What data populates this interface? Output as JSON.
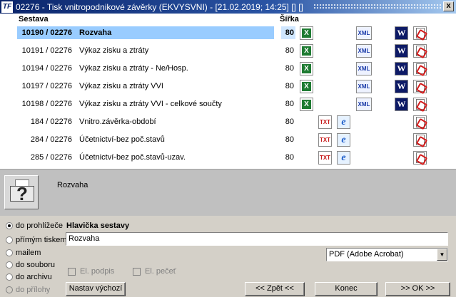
{
  "window": {
    "title": "02276 - Tisk vnitropodnikové závěrky (EKVYSVNI) - [21.02.2019; 14:25] [] []",
    "app_icon": "TF",
    "close_label": "x"
  },
  "list": {
    "headers": {
      "sestava": "Sestava",
      "sirka": "Šířka"
    },
    "rows": [
      {
        "code": "10190 / 02276",
        "name": "Rozvaha",
        "width": "80",
        "selected": true,
        "icons": [
          "xls-icon",
          "xml-icon",
          "word-icon",
          "pdf-icon"
        ]
      },
      {
        "code": "10191 / 02276",
        "name": "Výkaz zisku a ztráty",
        "width": "80",
        "icons": [
          "xls-icon",
          "xml-icon",
          "word-icon",
          "pdf-icon"
        ]
      },
      {
        "code": "10194 / 02276",
        "name": "Výkaz zisku a ztráty - Ne/Hosp.",
        "width": "80",
        "icons": [
          "xls-icon",
          "xml-icon",
          "word-icon",
          "pdf-icon"
        ]
      },
      {
        "code": "10197 / 02276",
        "name": "Výkaz zisku a ztráty VVI",
        "width": "80",
        "icons": [
          "xls-icon",
          "xml-icon",
          "word-icon",
          "pdf-icon"
        ]
      },
      {
        "code": "10198 / 02276",
        "name": "Výkaz zisku a ztráty VVI - celkové součty",
        "width": "80",
        "icons": [
          "xls-icon",
          "xml-icon",
          "word-icon",
          "pdf-icon"
        ]
      },
      {
        "code": "184 / 02276",
        "name": "Vnitro.závěrka-období",
        "width": "80",
        "icons": [
          "txt-icon",
          "ie-icon",
          "pdf-icon"
        ]
      },
      {
        "code": "284 / 02276",
        "name": "Účetnictví-bez poč.stavů",
        "width": "80",
        "icons": [
          "txt-icon",
          "ie-icon",
          "pdf-icon"
        ]
      },
      {
        "code": "285 / 02276",
        "name": "Účetnictví-bez poč.stavů-uzav.",
        "width": "80",
        "icons": [
          "txt-icon",
          "ie-icon",
          "pdf-icon"
        ]
      }
    ]
  },
  "info": {
    "selected_name": "Rozvaha",
    "icon": "printer-question-icon"
  },
  "output": {
    "options": [
      {
        "label": "do prohlížeče",
        "checked": true
      },
      {
        "label": "přímým tiskem"
      },
      {
        "label": "mailem"
      },
      {
        "label": "do souboru"
      },
      {
        "label": "do archivu"
      },
      {
        "label": "do přílohy",
        "disabled": true
      }
    ],
    "header_label": "Hlavička sestavy",
    "header_value": "Rozvaha",
    "format_selected": "PDF (Adobe Acrobat)",
    "el_podpis": "El. podpis",
    "el_pecet": "El. pečeť"
  },
  "buttons": {
    "nastav": "Nastav výchozí",
    "zpet": "<< Zpět <<",
    "konec": "Konec",
    "ok": ">> OK >>"
  },
  "icon_text": {
    "xls": "X",
    "xml": "XML",
    "doc": "W",
    "txt": "TXT",
    "ie": "e"
  }
}
